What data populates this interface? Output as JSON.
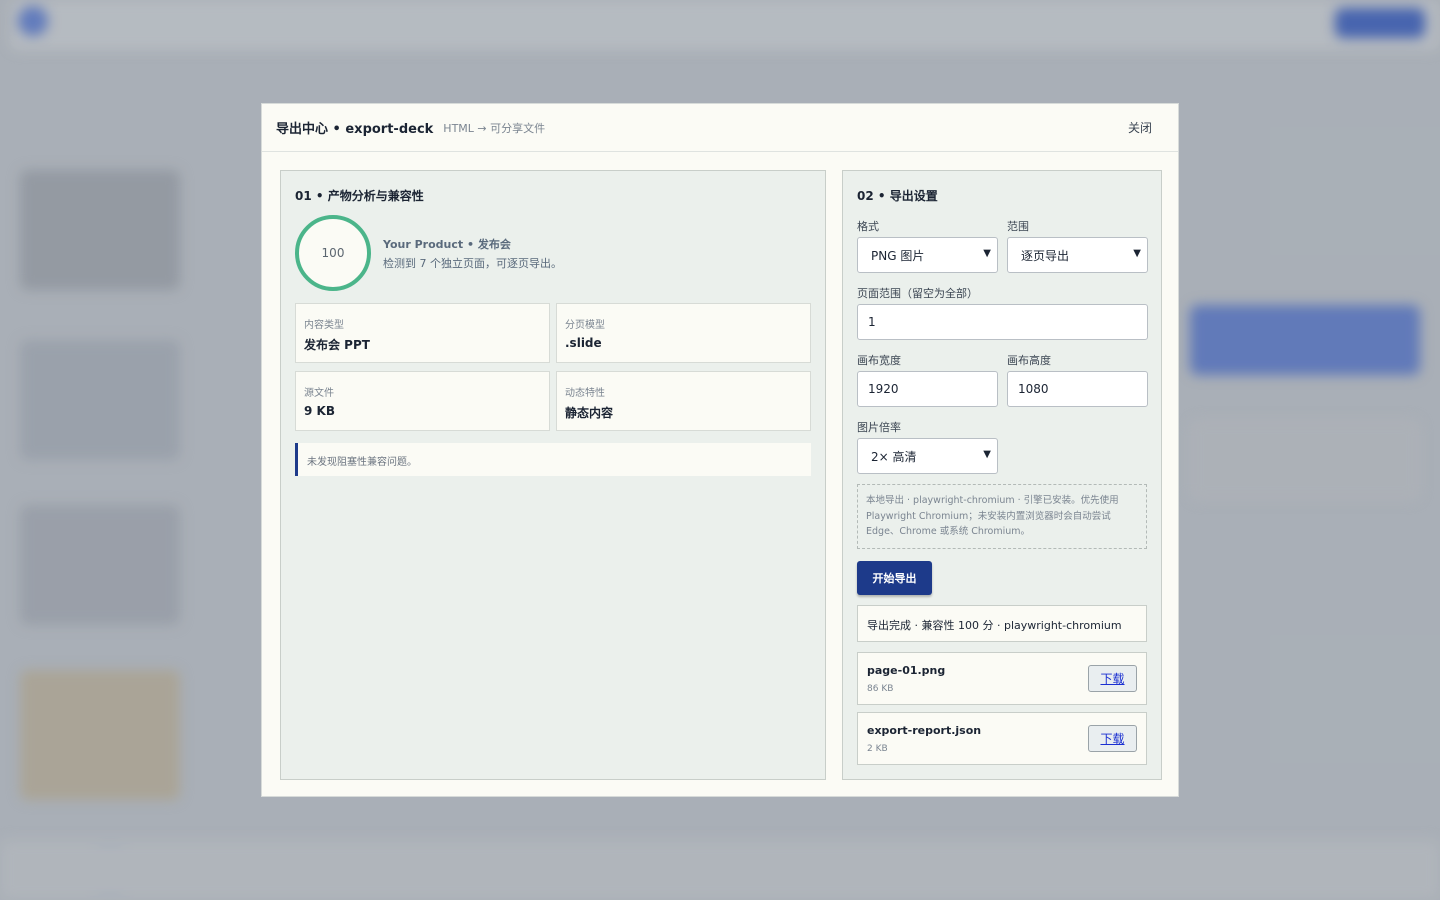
{
  "modal": {
    "title": "导出中心 • export-deck",
    "subtitle": "HTML → 可分享文件",
    "close_label": "关闭"
  },
  "analysis": {
    "section_title": "01 • 产物分析与兼容性",
    "score": "100",
    "product_name": "Your Product • 发布会",
    "product_desc": "检测到 7 个独立页面，可逐页导出。",
    "cards": [
      {
        "label": "内容类型",
        "value": "发布会 PPT"
      },
      {
        "label": "分页模型",
        "value": ".slide"
      },
      {
        "label": "源文件",
        "value": "9 KB"
      },
      {
        "label": "动态特性",
        "value": "静态内容"
      }
    ],
    "notice": "未发现阻塞性兼容问题。"
  },
  "settings": {
    "section_title": "02 • 导出设置",
    "format_label": "格式",
    "format_value": "PNG 图片",
    "range_label": "范围",
    "range_value": "逐页导出",
    "page_range_label": "页面范围（留空为全部）",
    "page_range_value": "1",
    "width_label": "画布宽度",
    "width_value": "1920",
    "height_label": "画布高度",
    "height_value": "1080",
    "scale_label": "图片倍率",
    "scale_value": "2× 高清",
    "hint_lines": [
      "本地导出 · playwright-chromium · 引擎已安装。优先使用",
      "Playwright Chromium；未安装内置浏览器时会自动尝试",
      "Edge、Chrome 或系统 Chromium。"
    ],
    "export_button": "开始导出",
    "status": "导出完成 · 兼容性 100 分 · playwright-chromium",
    "files": [
      {
        "name": "page-01.png",
        "size": "86 KB",
        "download": "下载"
      },
      {
        "name": "export-report.json",
        "size": "2 KB",
        "download": "下载"
      }
    ]
  },
  "colors": {
    "accent": "#1d3a8a",
    "score_ring": "#4bb58a",
    "panel_bg": "#ebf0ec",
    "modal_bg": "#fbfbf5"
  }
}
